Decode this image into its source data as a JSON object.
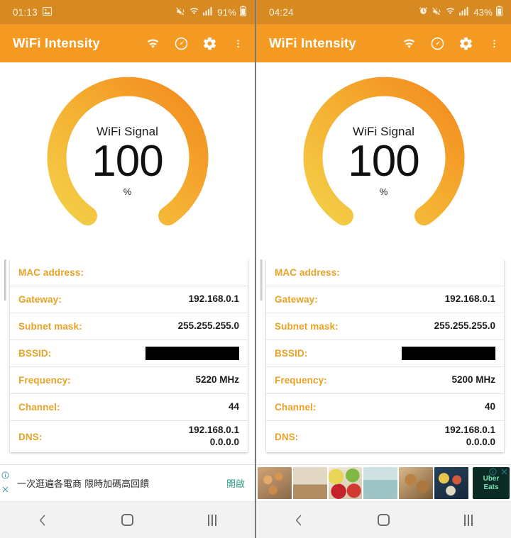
{
  "app": {
    "title": "WiFi Intensity",
    "accent": "#f49a22",
    "statusbar_bg": "#d78a22",
    "label_color": "#e8a325"
  },
  "toolbar": {
    "wifi_icon": "wifi-icon",
    "speed_icon": "speedometer-icon",
    "settings_icon": "gear-icon",
    "overflow_icon": "overflow-menu-icon"
  },
  "nav": {
    "back": "back-icon",
    "home": "home-icon",
    "recents": "recents-icon"
  },
  "phones": [
    {
      "id": "left",
      "statusbar": {
        "clock": "01:13",
        "battery_percent": "91%",
        "icons": [
          "image-icon",
          "mute-icon",
          "wifi-icon",
          "signal-bars-icon",
          "battery-icon"
        ],
        "has_alarm": false,
        "has_gallery": true
      },
      "gauge": {
        "label": "WiFi Signal",
        "value": "100",
        "unit": "%",
        "percent": 100,
        "color_start": "#f3ce47",
        "color_end": "#f28a1e"
      },
      "info_rows": [
        {
          "label": "MAC address:",
          "value": "",
          "type": "text"
        },
        {
          "label": "Gateway:",
          "value": "192.168.0.1",
          "type": "text"
        },
        {
          "label": "Subnet mask:",
          "value": "255.255.255.0",
          "type": "text"
        },
        {
          "label": "BSSID:",
          "value": "",
          "type": "redacted"
        },
        {
          "label": "Frequency:",
          "value": "5220 MHz",
          "type": "text"
        },
        {
          "label": "Channel:",
          "value": "44",
          "type": "text"
        },
        {
          "label": "DNS:",
          "value": "192.168.0.1\n0.0.0.0",
          "type": "multiline"
        }
      ],
      "ad": {
        "type": "text",
        "text": "一次逛遍各電商 限時加碼高回饋",
        "cta": "開啟",
        "info_icon": "ad-info-icon",
        "close_icon": "ad-close-icon"
      }
    },
    {
      "id": "right",
      "statusbar": {
        "clock": "04:24",
        "battery_percent": "43%",
        "icons": [
          "alarm-icon",
          "mute-icon",
          "wifi-icon",
          "signal-bars-icon",
          "battery-icon"
        ],
        "has_alarm": true,
        "has_gallery": false
      },
      "gauge": {
        "label": "WiFi Signal",
        "value": "100",
        "unit": "%",
        "percent": 100,
        "color_start": "#f3ce47",
        "color_end": "#f28a1e"
      },
      "info_rows": [
        {
          "label": "MAC address:",
          "value": "",
          "type": "text"
        },
        {
          "label": "Gateway:",
          "value": "192.168.0.1",
          "type": "text"
        },
        {
          "label": "Subnet mask:",
          "value": "255.255.255.0",
          "type": "text"
        },
        {
          "label": "BSSID:",
          "value": "",
          "type": "redacted"
        },
        {
          "label": "Frequency:",
          "value": "5200 MHz",
          "type": "text"
        },
        {
          "label": "Channel:",
          "value": "40",
          "type": "text"
        },
        {
          "label": "DNS:",
          "value": "192.168.0.1\n0.0.0.0",
          "type": "multiline"
        }
      ],
      "ad": {
        "type": "carousel",
        "brand_line1": "Uber",
        "brand_line2": "Eats",
        "tiles": 6,
        "info_icon": "ad-info-icon",
        "close_icon": "ad-close-icon"
      }
    }
  ]
}
